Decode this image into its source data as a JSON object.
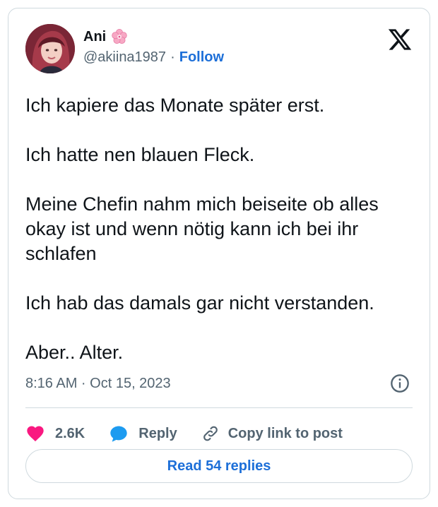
{
  "author": {
    "name": "Ani",
    "handle": "@akiina1987",
    "separator": "·",
    "follow_label": "Follow",
    "avatar_icon": "profile-photo",
    "name_emoji_icon": "cherry-blossom-icon"
  },
  "brand_icon": "x-logo-icon",
  "tweet": {
    "paragraphs": [
      "Ich kapiere das Monate später erst.",
      "Ich hatte nen blauen Fleck.",
      "Meine Chefin nahm mich beiseite ob alles okay ist und wenn nötig kann ich bei ihr schlafen",
      "Ich hab das damals gar nicht verstanden.",
      "Aber.. Alter."
    ],
    "timestamp": "8:16 AM · Oct 15, 2023"
  },
  "actions": {
    "likes": "2.6K",
    "reply_label": "Reply",
    "copy_link_label": "Copy link to post"
  },
  "read_replies_label": "Read 54 replies",
  "colors": {
    "accent": "#1d6fd8",
    "heart": "#f91880",
    "reply_bubble": "#1d9bf0",
    "muted_text": "#536471",
    "border": "#cfd9de"
  }
}
